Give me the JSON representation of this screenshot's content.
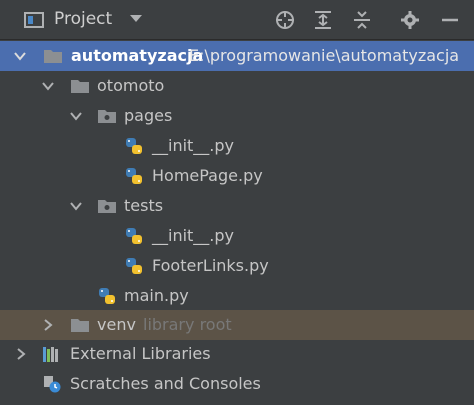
{
  "toolbar": {
    "title": "Project",
    "icons": [
      "project-view-icon",
      "dropdown-icon",
      "locate-icon",
      "expand-all-icon",
      "collapse-all-icon",
      "gear-icon",
      "minimize-icon"
    ]
  },
  "tree": {
    "root": {
      "label": "automatyzacja",
      "path": "E:\\programowanie\\automatyzacja"
    },
    "otomoto": {
      "label": "otomoto"
    },
    "pages": {
      "label": "pages"
    },
    "pages_init": {
      "label": "__init__.py"
    },
    "homepage": {
      "label": "HomePage.py"
    },
    "tests": {
      "label": "tests"
    },
    "tests_init": {
      "label": "__init__.py"
    },
    "footerlinks": {
      "label": "FooterLinks.py"
    },
    "main": {
      "label": "main.py"
    },
    "venv": {
      "label": "venv",
      "hint": "library root"
    },
    "external": {
      "label": "External Libraries"
    },
    "scratches": {
      "label": "Scratches and Consoles"
    }
  }
}
